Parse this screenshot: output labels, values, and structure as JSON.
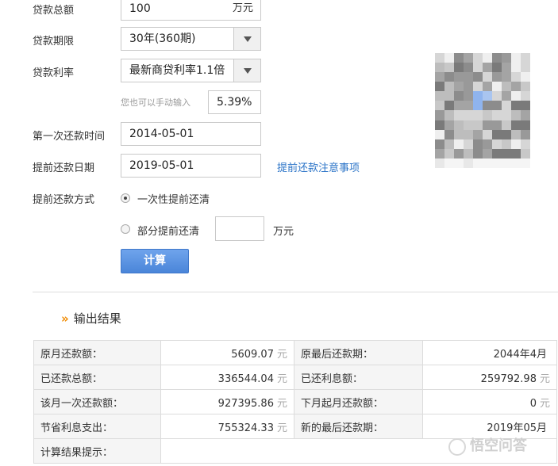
{
  "form": {
    "total_label": "贷款总额",
    "total_value": "100",
    "total_unit": "万元",
    "term_label": "贷款期限",
    "term_value": "30年(360期)",
    "rate_label": "贷款利率",
    "rate_value": "最新商贷利率1.1倍",
    "manual_hint": "您也可以手动输入",
    "manual_rate": "5.39%",
    "first_pay_label": "第一次还款时间",
    "first_pay_value": "2014-05-01",
    "prepay_date_label": "提前还款日期",
    "prepay_date_value": "2019-05-01",
    "prepay_notice_link": "提前还款注意事项",
    "prepay_mode_label": "提前还款方式",
    "mode_full": "一次性提前还清",
    "mode_partial": "部分提前还清",
    "partial_value": "",
    "partial_unit": "万元",
    "calc_button": "计算"
  },
  "result": {
    "title": "输出结果",
    "yuan": "元",
    "rows": [
      {
        "k1": "原月还款额：",
        "v1": "5609.07",
        "u1": "元",
        "k2": "原最后还款期：",
        "v2": "2044年4月",
        "u2": ""
      },
      {
        "k1": "已还款总额：",
        "v1": "336544.04",
        "u1": "元",
        "k2": "已还利息额：",
        "v2": "259792.98",
        "u2": "元"
      },
      {
        "k1": "该月一次还款额：",
        "v1": "927395.86",
        "u1": "元",
        "k2": "下月起月还款额：",
        "v2": "0",
        "u2": "元"
      },
      {
        "k1": "节省利息支出：",
        "v1": "755324.33",
        "u1": "元",
        "k2": "新的最后还款期：",
        "v2": "2019年05月",
        "u2": ""
      },
      {
        "k1": "计算结果提示：",
        "v1": "",
        "u1": "",
        "k2": "",
        "v2": "",
        "u2": ""
      }
    ]
  },
  "watermark": {
    "text": "悟空问答"
  },
  "colors": {
    "accent_blue": "#4a85d9",
    "link_blue": "#2a73c7",
    "orange": "#f08a00"
  }
}
